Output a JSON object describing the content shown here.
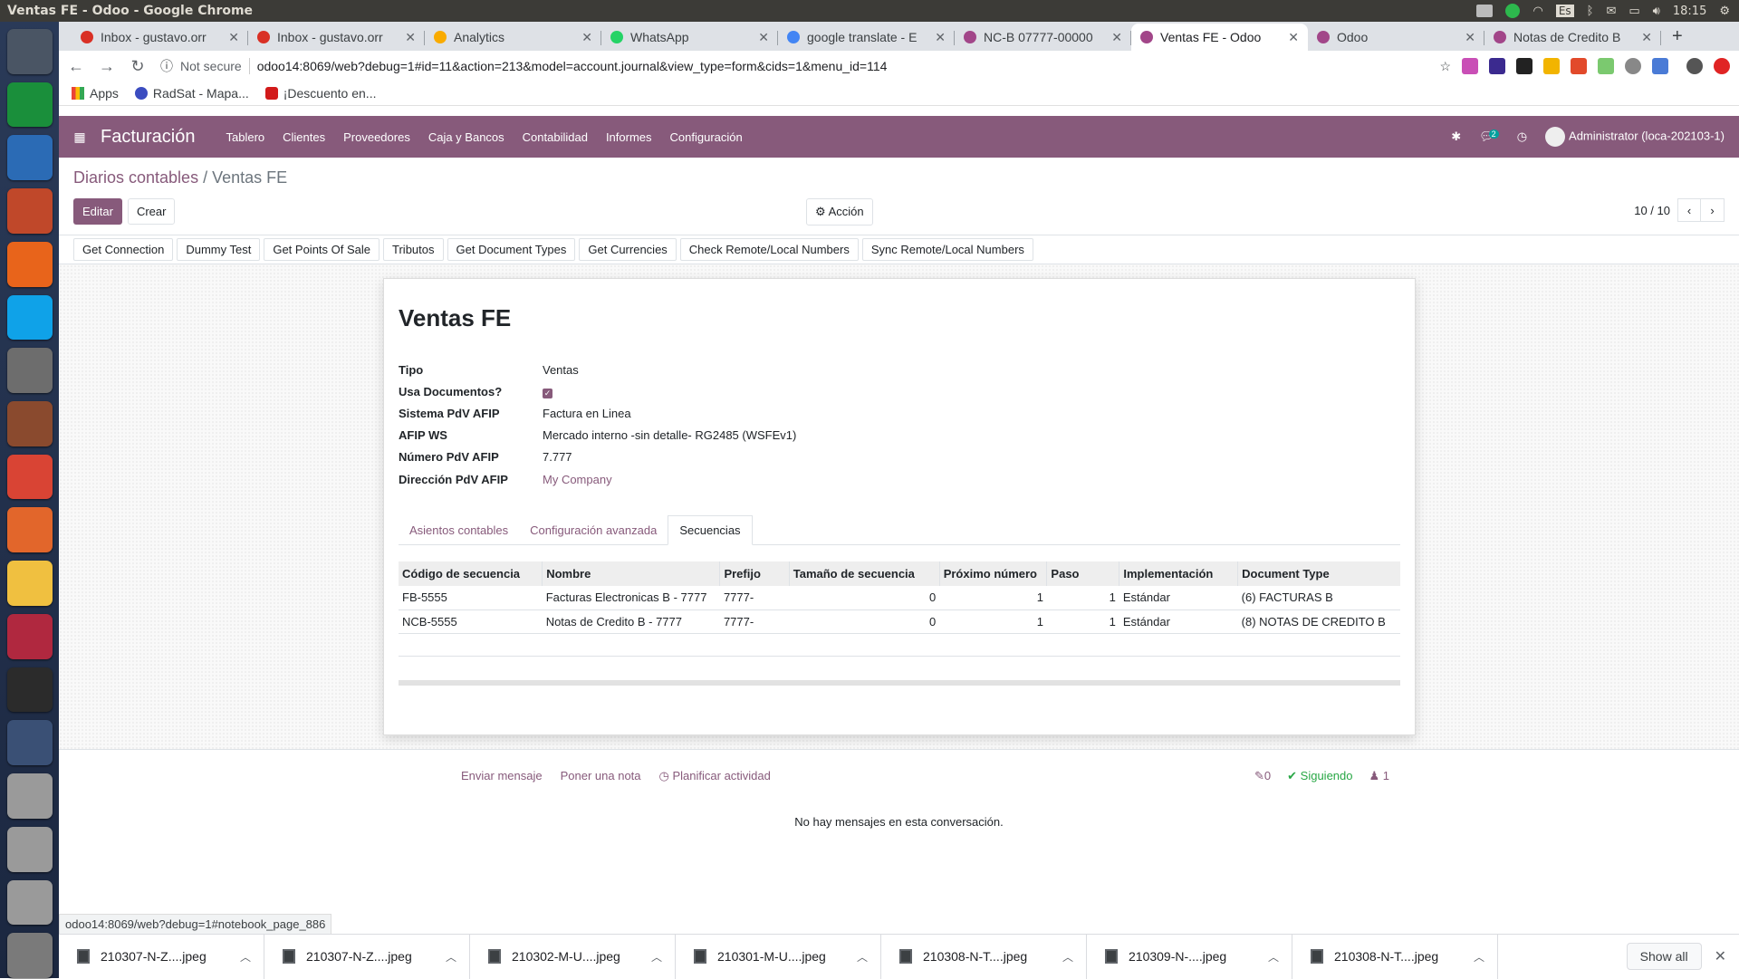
{
  "os": {
    "window_title": "Ventas FE - Odoo - Google Chrome",
    "time": "18:15",
    "keyboard": "Es"
  },
  "launcher": [
    {
      "name": "ubuntu-dash-icon",
      "color": "#4a5564"
    },
    {
      "name": "calc-icon",
      "color": "#1a8f3b"
    },
    {
      "name": "writer-icon",
      "color": "#2b6bb5"
    },
    {
      "name": "impress-icon",
      "color": "#c0482a"
    },
    {
      "name": "firefox-icon",
      "color": "#e8641b"
    },
    {
      "name": "skype-icon",
      "color": "#0fa2e8"
    },
    {
      "name": "settings-icon",
      "color": "#6d6d6d"
    },
    {
      "name": "files-icon",
      "color": "#8a4a2e"
    },
    {
      "name": "chrome-icon",
      "color": "#d94434"
    },
    {
      "name": "software-center-icon",
      "color": "#e2662b"
    },
    {
      "name": "text-editor-icon",
      "color": "#f0c040"
    },
    {
      "name": "disk-icon",
      "color": "#b0283f"
    },
    {
      "name": "terminal-icon",
      "color": "#2b2b2b"
    },
    {
      "name": "workspace-icon",
      "color": "#3a5075"
    },
    {
      "name": "drive-icon-1",
      "color": "#9a9a9a"
    },
    {
      "name": "drive-icon-2",
      "color": "#9a9a9a"
    },
    {
      "name": "drive-icon-3",
      "color": "#9a9a9a"
    },
    {
      "name": "trash-icon",
      "color": "#7a7a7a"
    }
  ],
  "tabs": [
    {
      "label": "Inbox - gustavo.orr",
      "fav": "#d93025",
      "active": false
    },
    {
      "label": "Inbox - gustavo.orr",
      "fav": "#d93025",
      "active": false
    },
    {
      "label": "Analytics",
      "fav": "#f9ab00",
      "active": false
    },
    {
      "label": "WhatsApp",
      "fav": "#25d366",
      "active": false
    },
    {
      "label": "google translate - E",
      "fav": "#4285f4",
      "active": false
    },
    {
      "label": "NC-B 07777-00000",
      "fav": "#a24689",
      "active": false
    },
    {
      "label": "Ventas FE - Odoo",
      "fav": "#a24689",
      "active": true
    },
    {
      "label": "Odoo",
      "fav": "#a24689",
      "active": false
    },
    {
      "label": "Notas de Credito B",
      "fav": "#a24689",
      "active": false
    }
  ],
  "omnibar": {
    "not_secure": "Not secure",
    "url": "odoo14:8069/web?debug=1#id=11&action=213&model=account.journal&view_type=form&cids=1&menu_id=114"
  },
  "bookmarks": {
    "apps": "Apps",
    "radsat": "RadSat - Mapa...",
    "descuento": "¡Descuento en..."
  },
  "navbar": {
    "app_name": "Facturación",
    "menu": [
      "Tablero",
      "Clientes",
      "Proveedores",
      "Caja y Bancos",
      "Contabilidad",
      "Informes",
      "Configuración"
    ],
    "chat_badge": "2",
    "user": "Administrator (loca-202103-1)",
    "color": "#875a7b"
  },
  "control": {
    "breadcrumb_parent": "Diarios contables",
    "breadcrumb_sep": " / ",
    "breadcrumb_current": "Ventas FE",
    "edit": "Editar",
    "create": "Crear",
    "action": "Acción",
    "pager": "10 / 10"
  },
  "header_buttons": [
    "Get Connection",
    "Dummy Test",
    "Get Points Of Sale",
    "Tributos",
    "Get Document Types",
    "Get Currencies",
    "Check Remote/Local Numbers",
    "Sync Remote/Local Numbers"
  ],
  "form": {
    "title": "Ventas FE",
    "fields": [
      {
        "label": "Tipo",
        "value": "Ventas",
        "kind": "text"
      },
      {
        "label": "Usa Documentos?",
        "value": "",
        "kind": "checkbox",
        "checked": true
      },
      {
        "label": "Sistema PdV AFIP",
        "value": "Factura en Linea",
        "kind": "text"
      },
      {
        "label": "AFIP WS",
        "value": "Mercado interno -sin detalle- RG2485 (WSFEv1)",
        "kind": "text"
      },
      {
        "label": "Número PdV AFIP",
        "value": "7.777",
        "kind": "text"
      },
      {
        "label": "Dirección PdV AFIP",
        "value": "My Company",
        "kind": "link"
      }
    ],
    "notebook_tabs": [
      {
        "label": "Asientos contables",
        "active": false
      },
      {
        "label": "Configuración avanzada",
        "active": false
      },
      {
        "label": "Secuencias",
        "active": true
      }
    ],
    "table": {
      "headers": [
        "Código de secuencia",
        "Nombre",
        "Prefijo",
        "Tamaño de secuencia",
        "Próximo número",
        "Paso",
        "Implementación",
        "Document Type"
      ],
      "rows": [
        [
          "FB-5555",
          "Facturas Electronicas B - 7777",
          "7777-",
          "0",
          "1",
          "1",
          "Estándar",
          "(6) FACTURAS B"
        ],
        [
          "NCB-5555",
          "Notas de Credito B - 7777",
          "7777-",
          "0",
          "1",
          "1",
          "Estándar",
          "(8) NOTAS DE CREDITO B"
        ]
      ]
    }
  },
  "chatter": {
    "send_message": "Enviar mensaje",
    "log_note": "Poner una nota",
    "schedule": "Planificar actividad",
    "attachments": "0",
    "following": "Siguiendo",
    "followers": "1",
    "empty": "No hay mensajes en esta conversación."
  },
  "status_url": "odoo14:8069/web?debug=1#notebook_page_886",
  "downloads": {
    "items": [
      "210307-N-Z....jpeg",
      "210307-N-Z....jpeg",
      "210302-M-U....jpeg",
      "210301-M-U....jpeg",
      "210308-N-T....jpeg",
      "210309-N-....jpeg",
      "210308-N-T....jpeg"
    ],
    "show_all": "Show all"
  }
}
